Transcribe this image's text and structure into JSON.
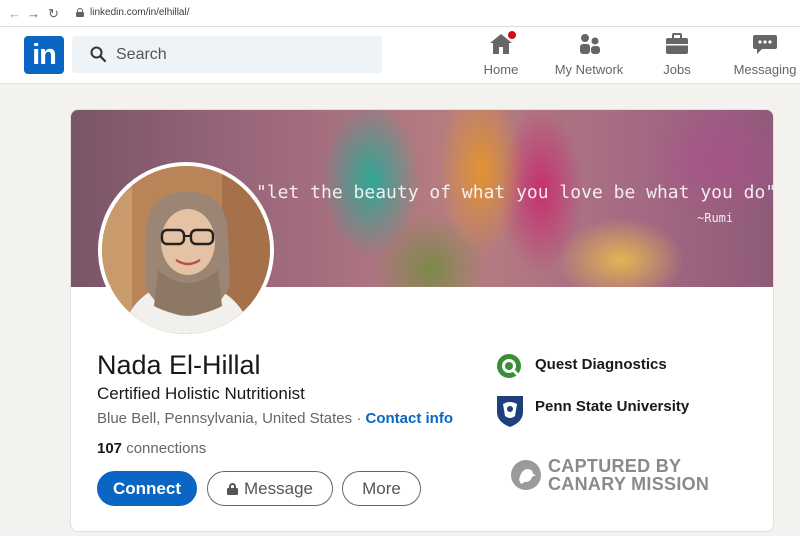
{
  "browser": {
    "url": "linkedin.com/in/elhillal/"
  },
  "header": {
    "logo_text": "in",
    "search_placeholder": "Search",
    "nav": {
      "home": "Home",
      "network": "My Network",
      "jobs": "Jobs",
      "messaging": "Messaging"
    }
  },
  "banner": {
    "quote": "\"let the beauty of what you love be what you do\"",
    "attribution": "~Rumi"
  },
  "profile": {
    "name": "Nada El-Hillal",
    "headline": "Certified Holistic Nutritionist",
    "location": "Blue Bell, Pennsylvania, United States",
    "separator": " · ",
    "contact_info": "Contact info",
    "connections_count": "107",
    "connections_label": " connections"
  },
  "actions": {
    "connect": "Connect",
    "message": "Message",
    "more": "More"
  },
  "experience": {
    "company": "Quest Diagnostics",
    "school": "Penn State University"
  },
  "watermark": {
    "line1": "CAPTURED BY",
    "line2": "CANARY MISSION"
  },
  "colors": {
    "brand": "#0a66c2",
    "notification": "#cc1016"
  }
}
